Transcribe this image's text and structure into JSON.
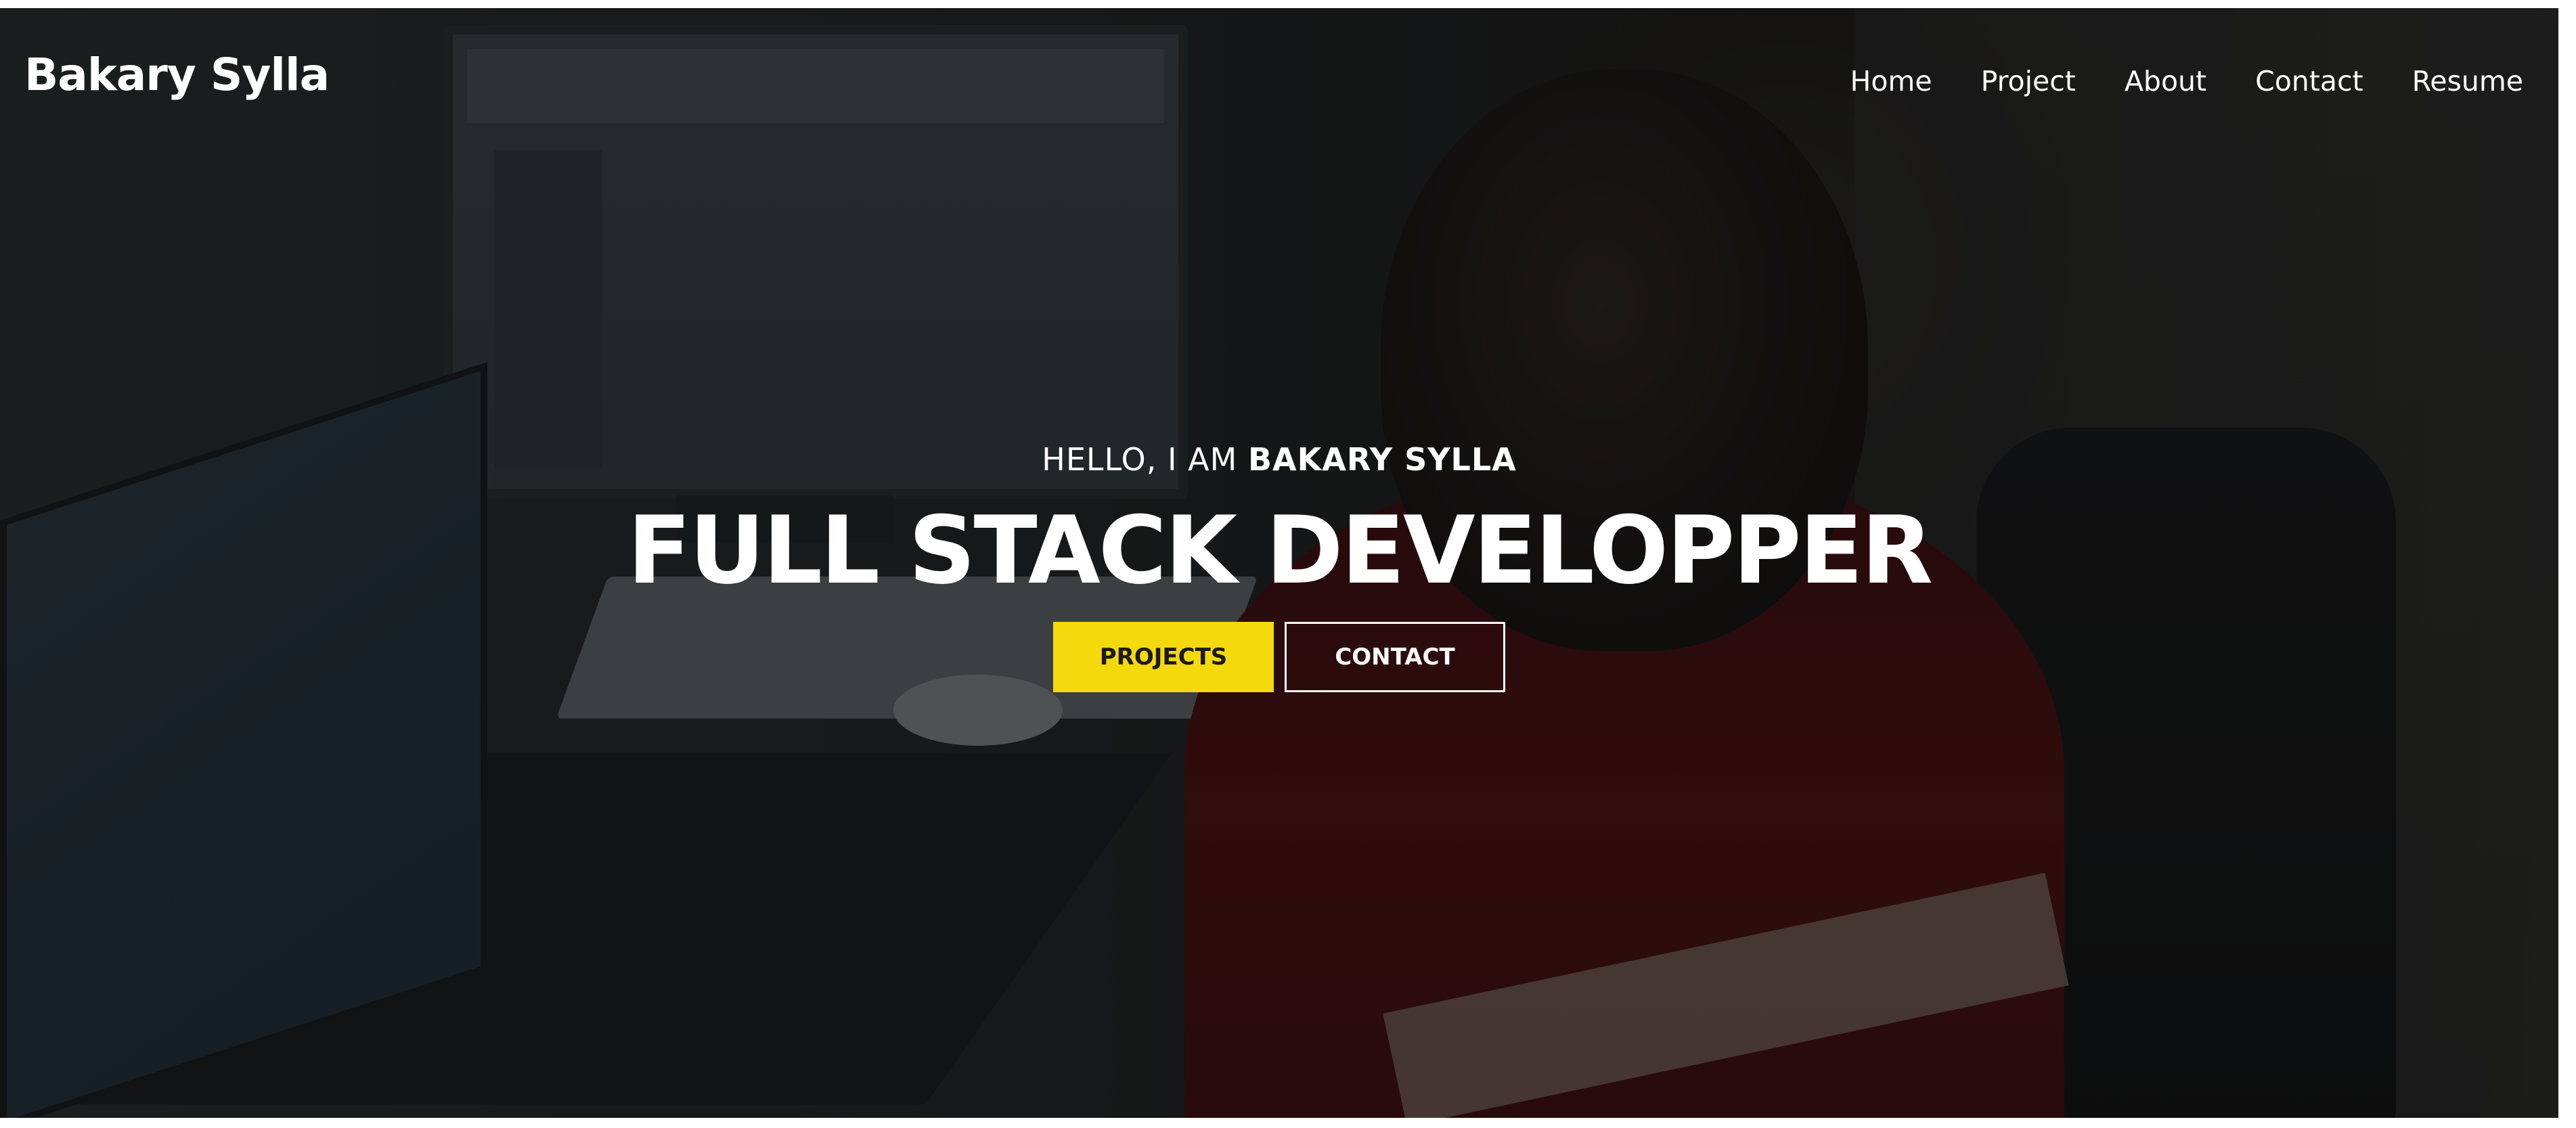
{
  "header": {
    "brand": "Bakary Sylla",
    "nav": [
      {
        "label": "Home"
      },
      {
        "label": "Project"
      },
      {
        "label": "About"
      },
      {
        "label": "Contact"
      },
      {
        "label": "Resume"
      }
    ]
  },
  "hero": {
    "greeting_prefix": "HELLO, I AM ",
    "greeting_name": "BAKARY SYLLA",
    "headline": "FULL STACK DEVELOPPER",
    "buttons": {
      "primary_label": "PROJECTS",
      "secondary_label": "CONTACT"
    }
  },
  "colors": {
    "accent": "#f4d90d",
    "text": "#ffffff"
  }
}
